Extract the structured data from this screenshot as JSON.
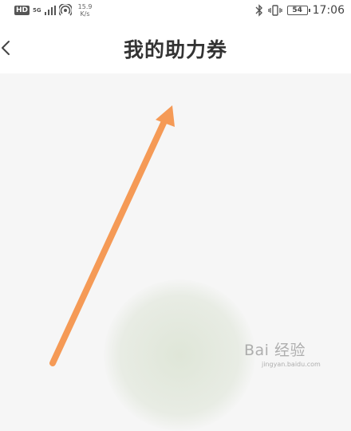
{
  "status_bar": {
    "hd": "HD",
    "network": "5G",
    "speed_value": "15.9",
    "speed_unit": "K/s",
    "battery": "54",
    "time": "17:06"
  },
  "header": {
    "title": "我的助力券",
    "back_icon": "chevron-left-icon"
  },
  "annotation": {
    "arrow_color": "#f59a56"
  },
  "watermark": {
    "main": "Bai 经验",
    "sub": "jingyan.baidu.com"
  }
}
